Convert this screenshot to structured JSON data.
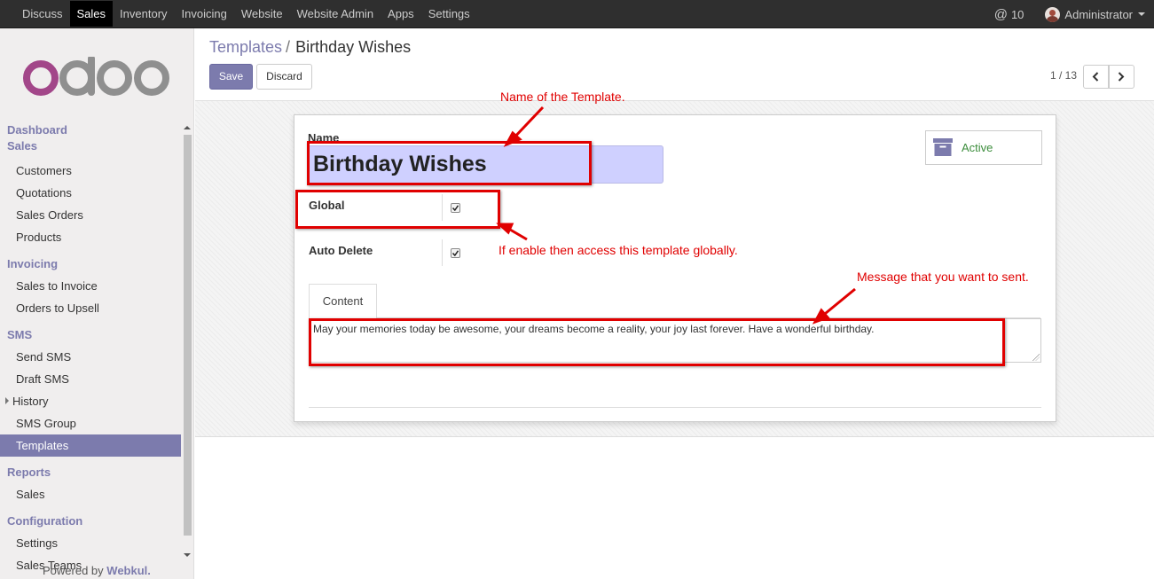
{
  "topbar": {
    "apps": [
      "Discuss",
      "Sales",
      "Inventory",
      "Invoicing",
      "Website",
      "Website Admin",
      "Apps",
      "Settings"
    ],
    "active_app": "Sales",
    "messages_count": "10",
    "user": "Administrator"
  },
  "sidebar": {
    "sections": [
      {
        "title": "Dashboard",
        "items": []
      },
      {
        "title": "Sales",
        "items": [
          "Customers",
          "Quotations",
          "Sales Orders",
          "Products"
        ]
      },
      {
        "title": "Invoicing",
        "items": [
          "Sales to Invoice",
          "Orders to Upsell"
        ]
      },
      {
        "title": "SMS",
        "items": [
          "Send SMS",
          "Draft SMS",
          "History",
          "SMS Group",
          "Templates"
        ]
      },
      {
        "title": "Reports",
        "items": [
          "Sales"
        ]
      },
      {
        "title": "Configuration",
        "items": [
          "Settings",
          "Sales Teams"
        ]
      }
    ],
    "active_item": "Templates",
    "powered_by": "Powered by",
    "powered_by_brand": "Webkul."
  },
  "breadcrumb": {
    "parent": "Templates",
    "separator": "/",
    "current": "Birthday Wishes"
  },
  "buttons": {
    "save": "Save",
    "discard": "Discard"
  },
  "pager": {
    "text": "1 / 13"
  },
  "form": {
    "name_label": "Name",
    "name_value": "Birthday Wishes",
    "global_label": "Global",
    "global_checked": true,
    "auto_delete_label": "Auto Delete",
    "auto_delete_checked": true,
    "active_label": "Active",
    "tab_content": "Content",
    "message": "May your memories today be awesome, your dreams become a reality, your joy last forever. Have a wonderful birthday."
  },
  "annotations": {
    "name_note": "Name of the Template.",
    "global_note": "If enable then access this template globally.",
    "message_note": "Message that you want to sent."
  },
  "colors": {
    "brand": "#7c7bad",
    "annotation": "#e00000",
    "active_green": "#3c8d3c"
  }
}
